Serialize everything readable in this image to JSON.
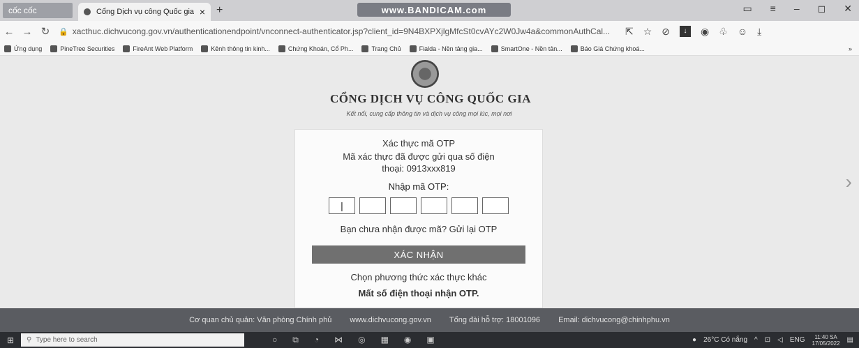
{
  "browser": {
    "app_tab": "cốc cốc",
    "tab_title": "Cổng Dịch vụ công Quốc gia",
    "tab_close": "×",
    "new_tab": "+",
    "watermark": "www.BANDICAM.com",
    "url": "xacthuc.dichvucong.gov.vn/authenticationendpoint/vnconnect-authenticator.jsp?client_id=9N4BXPXjlgMfcSt0cvAYc2W0Jw4a&commonAuthCal...",
    "bookmarks": [
      "Ứng dụng",
      "PineTree Securities",
      "FireAnt Web Platform",
      "Kênh thông tin kinh...",
      "Chứng Khoán, Cổ Ph...",
      "Trang Chủ",
      "Fialda - Nền tảng gia...",
      "SmartOne - Nền tản...",
      "Báo Giá Chứng khoá..."
    ]
  },
  "site": {
    "title": "CỔNG DỊCH VỤ CÔNG QUỐC GIA",
    "subtitle": "Kết nối, cung cấp thông tin và dịch vụ công mọi lúc, mọi nơi"
  },
  "otp": {
    "heading": "Xác thực mã OTP",
    "message": "Mã xác thực đã được gửi qua số điện thoại: 0913xxx819",
    "input_label": "Nhập mã OTP:",
    "first_digit": "|",
    "resend": "Bạn chưa nhận được mã? Gửi lại OTP",
    "confirm_button": "XÁC NHẬN",
    "other_method": "Chọn phương thức xác thực khác",
    "lost_phone": "Mất số điện thoại nhận OTP."
  },
  "footer": {
    "agency": "Cơ quan chủ quản: Văn phòng Chính phủ",
    "website": "www.dichvucong.gov.vn",
    "hotline": "Tổng đài hỗ trợ: 18001096",
    "email": "Email: dichvucong@chinhphu.vn"
  },
  "taskbar": {
    "search_placeholder": "Type here to search",
    "weather": "26°C Có nắng",
    "lang": "ENG",
    "time": "11:40 SA",
    "date": "17/05/2022"
  }
}
